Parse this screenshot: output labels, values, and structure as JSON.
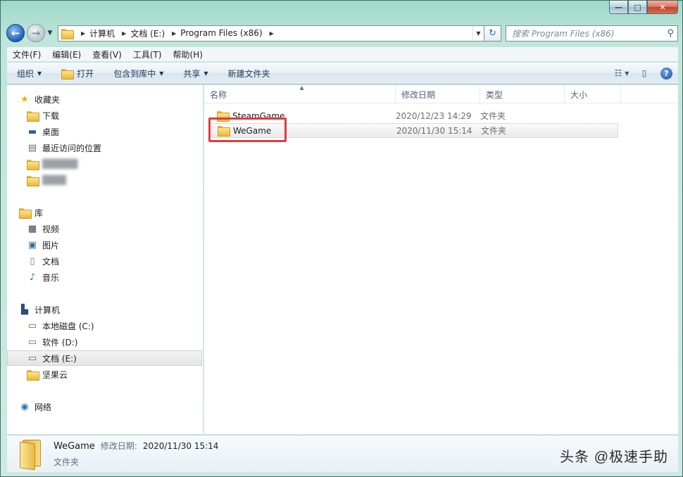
{
  "window": {
    "caption_buttons": {
      "minimize": "—",
      "maximize": "□",
      "close": "✕"
    }
  },
  "address": {
    "crumbs": [
      "计算机",
      "文档 (E:)",
      "Program Files (x86)"
    ],
    "search_placeholder": "搜索 Program Files (x86)"
  },
  "menubar": {
    "items": [
      "文件(F)",
      "编辑(E)",
      "查看(V)",
      "工具(T)",
      "帮助(H)"
    ]
  },
  "toolbar": {
    "organize": "组织",
    "open": "打开",
    "include_in_library": "包含到库中",
    "share": "共享",
    "new_folder": "新建文件夹",
    "help": "?"
  },
  "nav": {
    "favorites": {
      "header": "收藏夹",
      "items": [
        "下载",
        "桌面",
        "最近访问的位置",
        "██████",
        "████"
      ]
    },
    "libraries": {
      "header": "库",
      "items": [
        "视频",
        "图片",
        "文档",
        "音乐"
      ]
    },
    "computer": {
      "header": "计算机",
      "items": [
        "本地磁盘 (C:)",
        "软件 (D:)",
        "文档 (E:)",
        "坚果云"
      ]
    },
    "network": {
      "header": "网络"
    }
  },
  "columns": {
    "name": "名称",
    "modified": "修改日期",
    "type": "类型",
    "size": "大小"
  },
  "files": [
    {
      "name": "SteamGame",
      "modified": "2020/12/23 14:29",
      "type": "文件夹"
    },
    {
      "name": "WeGame",
      "modified": "2020/11/30 15:14",
      "type": "文件夹"
    }
  ],
  "details": {
    "name": "WeGame",
    "modified_label": "修改日期:",
    "modified": "2020/11/30 15:14",
    "type": "文件夹"
  },
  "watermark": "头条 @极速手助",
  "colors": {
    "highlight": "#e13b3b",
    "folder": "#e9b93a"
  }
}
